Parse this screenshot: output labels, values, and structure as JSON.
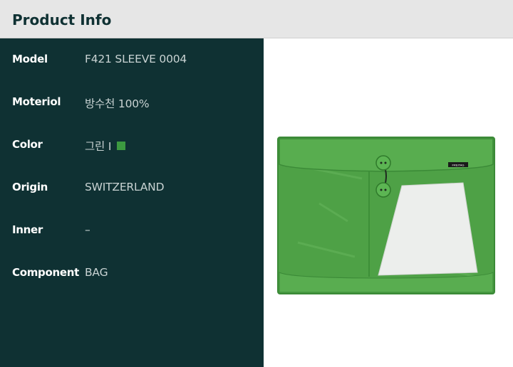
{
  "header": {
    "title": "Product Info"
  },
  "specs": [
    {
      "label": "Model",
      "value": "F421 SLEEVE 0004"
    },
    {
      "label": "Moteriol",
      "value": "방수천 100%"
    },
    {
      "label": "Color",
      "value": "그린 I"
    },
    {
      "label": "Origin",
      "value": "SWITZERLAND"
    },
    {
      "label": "Inner",
      "value": "–"
    },
    {
      "label": "Component",
      "value": "BAG"
    }
  ],
  "colors": {
    "header_bg": "#e6e6e6",
    "panel_bg": "#0f3133",
    "swatch": "#3c9a40",
    "product_green": "#4ea146"
  },
  "product_image": {
    "brand_tag": "FREITAG"
  }
}
